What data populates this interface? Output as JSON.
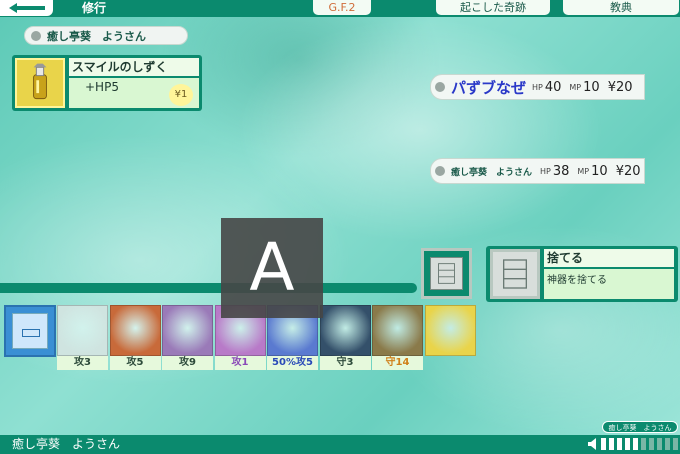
{
  "header": {
    "title": "修行",
    "gf": "G.F.2",
    "kiseki": "起こした奇跡",
    "kyoten": "教典"
  },
  "player": {
    "name": "癒し亭葵　ようさん"
  },
  "item": {
    "name": "スマイルのしずく",
    "effect": "+HP5",
    "price": "¥1",
    "icon": "potion-icon"
  },
  "enemy": {
    "name": "パずブなぜ",
    "hp_label": "HP",
    "hp": "40",
    "mp_label": "MP",
    "mp": "10",
    "money": "¥20"
  },
  "self": {
    "name": "癒し亭葵　ようさん",
    "hp_label": "HP",
    "hp": "38",
    "mp_label": "MP",
    "mp": "10",
    "money": "¥20"
  },
  "overlay": {
    "letter": "A"
  },
  "discard": {
    "title": "捨てる",
    "desc": "神器を捨てる"
  },
  "hand": [
    {
      "label": "攻3",
      "icon": "claw-icon",
      "color": "#cfe4e0"
    },
    {
      "label": "攻5",
      "icon": "sword-icon",
      "color": "#c86a3a"
    },
    {
      "label": "攻9",
      "icon": "spear-icon",
      "color": "#9a7ab8"
    },
    {
      "label": "攻1",
      "icon": "ring-icon",
      "color": "#b87ac8"
    },
    {
      "label": "50%攻5",
      "icon": "snowball-icon",
      "color": "#5a7ad0"
    },
    {
      "label": "守3",
      "icon": "gauntlet-icon",
      "color": "#34506a"
    },
    {
      "label": "守14",
      "icon": "flame-shield-icon",
      "color": "#8a7a4a"
    },
    {
      "label": "",
      "icon": "potion-icon",
      "color": "#e9d44a"
    }
  ],
  "footer": {
    "name": "癒し亭葵　ようさん",
    "mini_name": "癒し亭葵　ようさん",
    "volume": [
      1,
      1,
      1,
      1,
      1,
      0,
      0,
      0,
      0,
      0,
      0,
      0
    ]
  }
}
